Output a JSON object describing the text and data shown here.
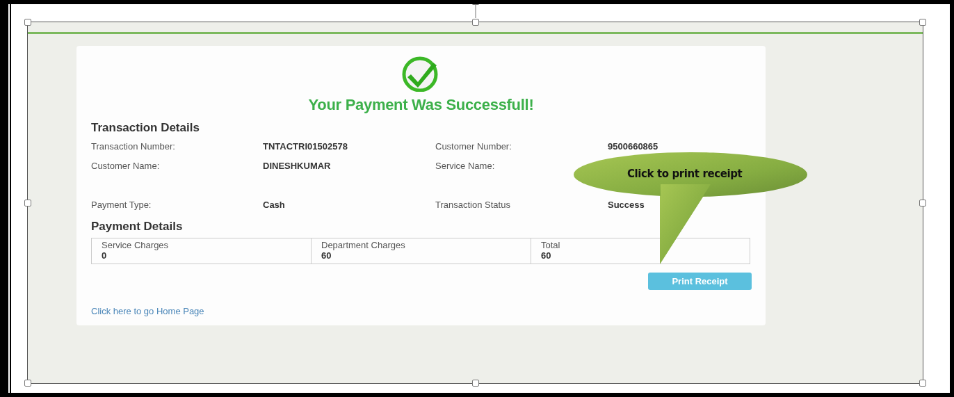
{
  "success": {
    "title": "Your Payment Was Successfull!"
  },
  "transaction_details": {
    "heading": "Transaction Details",
    "fields": [
      {
        "label": "Transaction Number:",
        "value": "TNTACTRI01502578"
      },
      {
        "label": "Customer Number:",
        "value": "9500660865"
      },
      {
        "label": "Customer Name:",
        "value": "DINESHKUMAR"
      },
      {
        "label": "Service Name:"
      },
      {
        "label": "Payment Type:",
        "value": "Cash"
      },
      {
        "label": "Transaction Status",
        "value": "Success"
      }
    ]
  },
  "payment_details": {
    "heading": "Payment Details",
    "columns": [
      {
        "label": "Service Charges",
        "value": "0"
      },
      {
        "label": "Department Charges",
        "value": "60"
      },
      {
        "label": "Total",
        "value": "60"
      }
    ]
  },
  "print_button": "Print Receipt",
  "home_link": "Click here to go Home Page",
  "callout": {
    "text": "Click to print receipt"
  }
}
